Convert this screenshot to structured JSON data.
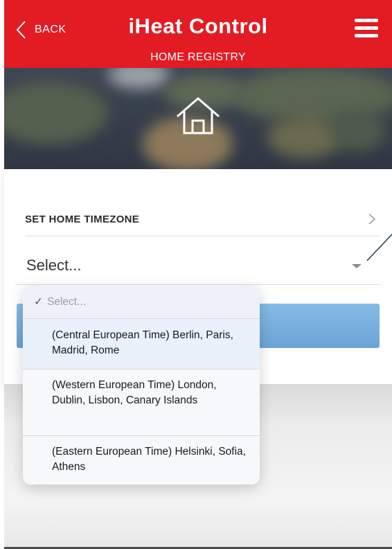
{
  "header": {
    "back_label": "BACK",
    "title": "iHeat Control",
    "subtitle": "HOME REGISTRY",
    "accent_color": "#e31b23"
  },
  "hero": {
    "icon": "house-outline-icon"
  },
  "timezone": {
    "section_label": "SET HOME TIMEZONE",
    "select_value": "Select..."
  },
  "dropdown": {
    "options": [
      {
        "label": "Select...",
        "selected": true
      },
      {
        "label": "(Central European Time) Berlin, Paris, Madrid, Rome"
      },
      {
        "label": "(Western European Time) London, Dublin, Lisbon, Canary Islands"
      },
      {
        "label": "(Eastern European Time) Helsinki, Sofia, Athens"
      }
    ],
    "check_mark": "✓"
  },
  "colors": {
    "button_blue": "#6aa3d6",
    "header_red": "#e31b23"
  }
}
